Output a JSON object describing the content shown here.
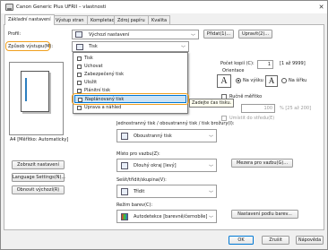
{
  "window": {
    "title": "Canon Generic Plus UFRII – vlastnosti",
    "close": "✕"
  },
  "tabs": [
    "Základní nastavení",
    "Výstup stran",
    "Kompletace",
    "Zdroj papíru",
    "Kvalita"
  ],
  "profile": {
    "label": "Profil:",
    "value": "Výchozí nastavení",
    "edit": "Přidat(1)...",
    "modify": "Upravit(2)..."
  },
  "output": {
    "label": "Způsob výstupu(M):",
    "value": "Tisk"
  },
  "dropdown": {
    "items": [
      "Tisk",
      "Uchovat",
      "Zabezpečený tisk",
      "Uložit",
      "Plánitní tisk",
      "Naplánovaný tisk",
      "Úprava a náhled"
    ],
    "selected_index": 5
  },
  "tooltip": "Zadejte čas tisku.",
  "copies": {
    "label": "Počet kopií (C):",
    "value": "1",
    "range": "[1 až 9999]"
  },
  "orientation": {
    "label": "Orientace",
    "portrait": "Na výšku",
    "landscape": "Na šířku"
  },
  "manual": {
    "label": "Ručně měřítko",
    "value": "100",
    "range": "% [25 až 200]"
  },
  "watermark": {
    "label": "Umístit do středu(E)"
  },
  "preview": {
    "caption": "A4 [Měřítko: Automaticky]"
  },
  "layout": {
    "label": "Jednostranný tisk / oboustranný tisk / tisk brožury(I):",
    "value": "Oboustranný tisk"
  },
  "binding": {
    "label": "Místo pro vazbu(Z):",
    "value": "Dlouhý okraj [levý]",
    "button": "Mezera pro vazbu(G)..."
  },
  "finishing": {
    "label": "Sešít/třídit/skupina(V):",
    "value": "Třídit"
  },
  "colour": {
    "label": "Režim barev(C):",
    "value": "Autodetekce [barevně/černobíle]",
    "button": "Nastavení podlu barev..."
  },
  "left_buttons": [
    "Zobrazit nastavení",
    "Language Settings(N)...",
    "Obnovit výchozí(R)"
  ],
  "dialog_buttons": {
    "ok": "OK",
    "cancel": "Zrušit",
    "help": "Nápověda"
  }
}
